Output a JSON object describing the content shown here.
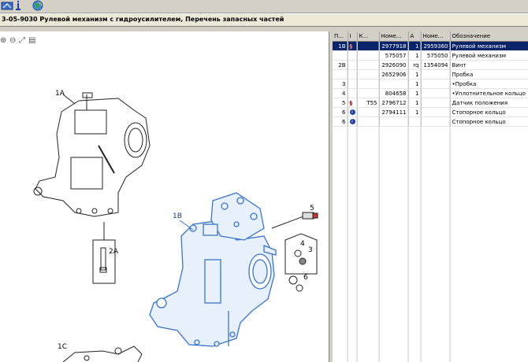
{
  "window": {
    "title": "3-05-9030 Рулевой механизм с гидроусилителем, Перечень запасных частей"
  },
  "toolbar": {
    "buttons": [
      {
        "icon": "tool-icon",
        "color": "#3a6fc4"
      },
      {
        "icon": "info-icon",
        "color": "#2040a0"
      },
      {
        "icon": "globe-icon",
        "color": "#3c8f3c"
      }
    ]
  },
  "drawing_tools": [
    {
      "icon": "zoom-in-icon",
      "glyph": "⊕"
    },
    {
      "icon": "zoom-out-icon",
      "glyph": "⊖"
    },
    {
      "icon": "fit-icon",
      "glyph": "⤢"
    },
    {
      "icon": "print-icon",
      "glyph": "▤"
    }
  ],
  "callouts": {
    "c1A": "1A",
    "c2A": "2A",
    "c1B": "1B",
    "c5": "5",
    "c4": "4",
    "c3": "3",
    "c6": "6",
    "c1C": "1C"
  },
  "parts_table": {
    "columns": [
      "П...",
      "I",
      "К...",
      "Номе...",
      "А",
      "Номе...",
      "Обозначение"
    ],
    "rows": [
      {
        "pos": "1B",
        "icon": "s",
        "k": "",
        "number": "2977918",
        "qty": "1",
        "number2": "2959360",
        "name": "Рулевой механизм",
        "selected": true
      },
      {
        "pos": "",
        "icon": "",
        "k": "",
        "number": "575057",
        "qty": "1",
        "number2": "575050",
        "name": "Рулевой механизм",
        "selected": false
      },
      {
        "pos": "2B",
        "icon": "",
        "k": "",
        "number": "2926090",
        "qty": "rq",
        "number2": "1354094",
        "name": "Винт",
        "selected": false
      },
      {
        "pos": "",
        "icon": "",
        "k": "",
        "number": "2652906",
        "qty": "1",
        "number2": "",
        "name": "Пробка",
        "selected": false
      },
      {
        "pos": "3",
        "icon": "",
        "k": "",
        "number": "",
        "qty": "1",
        "number2": "",
        "name": "•Пробка",
        "selected": false
      },
      {
        "pos": "4",
        "icon": "",
        "k": "",
        "number": "804658",
        "qty": "1",
        "number2": "",
        "name": "•Уплотнительное кольцо",
        "selected": false
      },
      {
        "pos": "5",
        "icon": "s",
        "k": "T55",
        "number": "2796712",
        "qty": "1",
        "number2": "",
        "name": "Датчик положения",
        "selected": false
      },
      {
        "pos": "6",
        "icon": "i",
        "k": "",
        "number": "2794111",
        "qty": "1",
        "number2": "",
        "name": "Стопорное кольцо",
        "selected": false
      },
      {
        "pos": "6",
        "icon": "i",
        "k": "",
        "number": "",
        "qty": "",
        "number2": "",
        "name": "Стопорное кольцо",
        "selected": false
      }
    ]
  }
}
